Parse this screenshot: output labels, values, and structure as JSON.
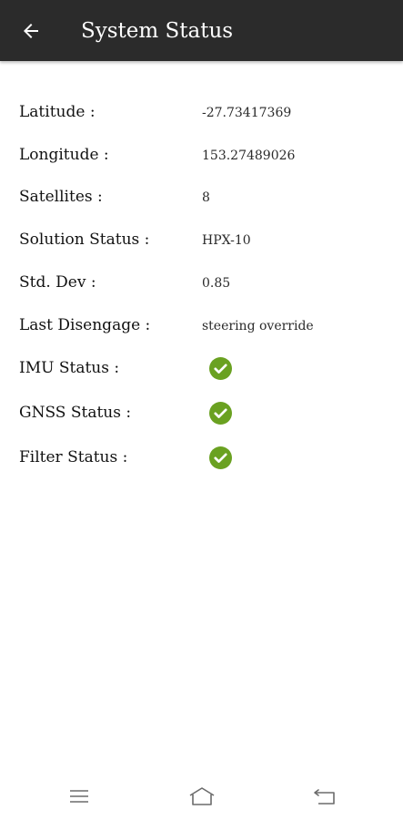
{
  "header": {
    "title": "System Status",
    "back_icon": "arrow-left-icon"
  },
  "status_rows": [
    {
      "label": "Latitude :",
      "value": "-27.73417369"
    },
    {
      "label": "Longitude :",
      "value": "153.27489026"
    },
    {
      "label": "Satellites :",
      "value": "8"
    },
    {
      "label": "Solution Status :",
      "value": "HPX-10"
    },
    {
      "label": "Std. Dev :",
      "value": "0.85"
    },
    {
      "label": "Last Disengage :",
      "value": "steering override"
    },
    {
      "label": "IMU Status :",
      "icon": "check-circle-icon"
    },
    {
      "label": "GNSS Status :",
      "icon": "check-circle-icon"
    },
    {
      "label": "Filter Status :",
      "icon": "check-circle-icon"
    }
  ],
  "nav_bar": {
    "icons": [
      "menu-icon",
      "home-icon",
      "back-icon"
    ]
  },
  "colors": {
    "appbar": "#2b2b2b",
    "ok_green": "#6aa121"
  }
}
